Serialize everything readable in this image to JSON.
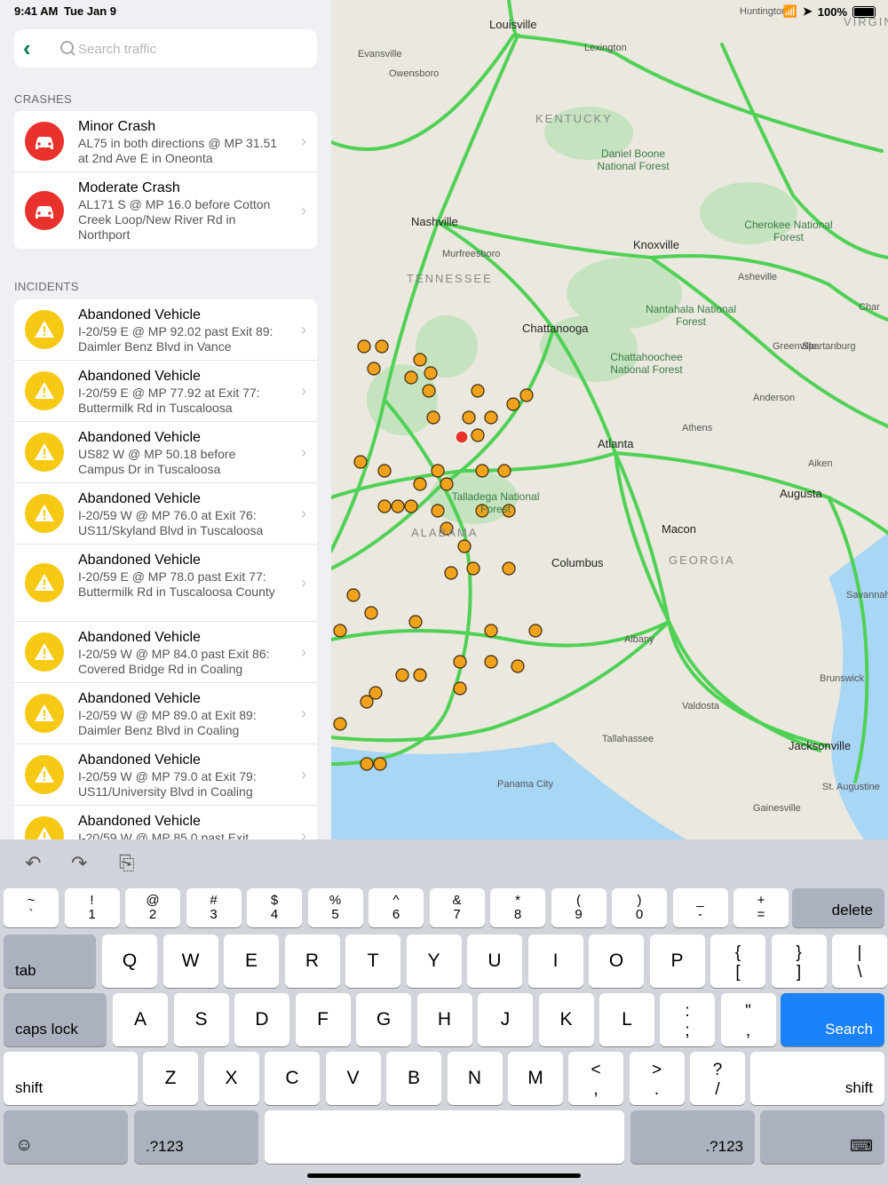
{
  "status": {
    "time": "9:41 AM",
    "date": "Tue Jan 9",
    "battery": "100%"
  },
  "search": {
    "placeholder": "Search traffic",
    "value": ""
  },
  "crashes": {
    "header": "CRASHES",
    "items": [
      {
        "title": "Minor Crash",
        "subtitle": "AL75 in both directions @ MP 31.51 at 2nd Ave E in Oneonta",
        "icon": "car-crash-icon"
      },
      {
        "title": "Moderate Crash",
        "subtitle": "AL171 S @ MP 16.0 before Cotton Creek Loop/New River Rd in Northport",
        "icon": "car-crash-icon"
      }
    ]
  },
  "incidents": {
    "header": "INCIDENTS",
    "items": [
      {
        "title": "Abandoned Vehicle",
        "subtitle": "I-20/59 E @ MP 92.02 past Exit 89: Daimler Benz Blvd in Vance"
      },
      {
        "title": "Abandoned Vehicle",
        "subtitle": "I-20/59 E @ MP 77.92 at Exit 77: Buttermilk Rd in Tuscaloosa"
      },
      {
        "title": "Abandoned Vehicle",
        "subtitle": "US82 W @ MP 50.18 before Campus Dr in Tuscaloosa"
      },
      {
        "title": "Abandoned Vehicle",
        "subtitle": "I-20/59 W @ MP 76.0 at Exit 76: US11/Skyland Blvd in Tuscaloosa"
      },
      {
        "title": "Abandoned Vehicle",
        "subtitle": "I-20/59 E @ MP 78.0 past Exit 77: Buttermilk Rd in Tuscaloosa County"
      },
      {
        "title": "Abandoned Vehicle",
        "subtitle": "I-20/59 W @ MP 84.0 past Exit 86: Covered Bridge Rd in Coaling"
      },
      {
        "title": "Abandoned Vehicle",
        "subtitle": "I-20/59 W @ MP 89.0 at Exit 89: Daimler Benz Blvd in Coaling"
      },
      {
        "title": "Abandoned Vehicle",
        "subtitle": "I-20/59 W @ MP 79.0 at Exit 79: US11/University Blvd in Coaling"
      },
      {
        "title": "Abandoned Vehicle",
        "subtitle": "I-20/59 W @ MP 85.0 past Exit"
      }
    ]
  },
  "map": {
    "cities": [
      "Louisville",
      "Nashville",
      "Chattanooga",
      "Atlanta",
      "Knoxville",
      "Columbus",
      "Macon",
      "Augusta",
      "Jacksonville",
      "Savannah",
      "Tallahassee",
      "Lexington",
      "Evansville",
      "Owensboro",
      "Murfreesboro",
      "Athens",
      "Albany",
      "Valdosta",
      "Asheville",
      "Greenville",
      "Spartanburg",
      "Anderson",
      "Aiken",
      "Brunswick",
      "Panama City",
      "Gainesville",
      "St. Augustine",
      "Huntington",
      "Char"
    ],
    "states": [
      "KENTUCKY",
      "TENNESSEE",
      "GEORGIA",
      "ALABAMA",
      "VIRGIN"
    ],
    "parks": [
      "Daniel Boone National Forest",
      "Cherokee National Forest",
      "Nantahala National Forest",
      "Chattahoochee National Forest",
      "Talladega National Forest"
    ],
    "road_color": "#4fd155"
  },
  "keyboard": {
    "row1": [
      [
        "~",
        "`"
      ],
      [
        "!",
        "1"
      ],
      [
        "@",
        "2"
      ],
      [
        "#",
        "3"
      ],
      [
        "$",
        "4"
      ],
      [
        "%",
        "5"
      ],
      [
        "^",
        "6"
      ],
      [
        "&",
        "7"
      ],
      [
        "*",
        "8"
      ],
      [
        "(",
        "9"
      ],
      [
        ")",
        "0"
      ],
      [
        "_",
        "-"
      ],
      [
        "+",
        "="
      ]
    ],
    "delete": "delete",
    "tab": "tab",
    "row2": [
      "Q",
      "W",
      "E",
      "R",
      "T",
      "Y",
      "U",
      "I",
      "O",
      "P"
    ],
    "row2sym": [
      [
        "{",
        "["
      ],
      [
        "}",
        "]"
      ],
      [
        "|",
        "\\"
      ]
    ],
    "caps": "caps lock",
    "row3": [
      "A",
      "S",
      "D",
      "F",
      "G",
      "H",
      "J",
      "K",
      "L"
    ],
    "row3sym": [
      [
        ":",
        ";"
      ],
      [
        "\"",
        ","
      ]
    ],
    "search": "Search",
    "shift": "shift",
    "row4": [
      "Z",
      "X",
      "C",
      "V",
      "B",
      "N",
      "M"
    ],
    "row4sym": [
      [
        "<",
        ","
      ],
      [
        ">",
        "."
      ],
      [
        "?",
        "/"
      ]
    ],
    "numbers": ".?123",
    "accent": "#1a82fb"
  }
}
